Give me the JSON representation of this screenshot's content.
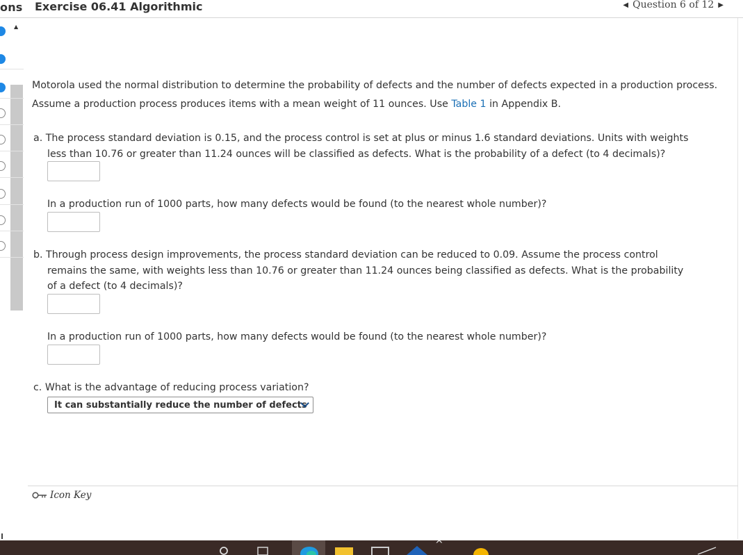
{
  "header": {
    "left_cut_text": "ons",
    "title": "Exercise 06.41 Algorithmic",
    "question_nav": "Question 6 of 12"
  },
  "question": {
    "intro_before_link": "Motorola used the normal distribution to determine the probability of defects and the number of defects expected in a production process. Assume a production process produces items with a mean weight of 11 ounces. Use ",
    "intro_link": "Table 1",
    "intro_after_link": " in Appendix B.",
    "part_a_lead": "a. The process standard deviation is 0.15, and the process control is set at plus or minus 1.6 standard deviations. Units with weights",
    "part_a_cont": "less than 10.76 or greater than 11.24 ounces will be classified as defects. What is the probability of a defect (to 4 decimals)?",
    "part_a_runs": "In a production run of 1000 parts, how many defects would be found (to the nearest whole number)?",
    "part_b_lead": "b. Through process design improvements, the process standard deviation can be reduced to 0.09. Assume the process control",
    "part_b_cont1": "remains the same, with weights less than 10.76 or greater than 11.24 ounces being classified as defects. What is the probability",
    "part_b_cont2": "of a defect (to 4 decimals)?",
    "part_b_runs": "In a production run of 1000 parts, how many defects would be found (to the nearest whole number)?",
    "part_c": "c. What is the advantage of reducing process variation?",
    "part_c_selected": "It can substantially reduce the number of defects",
    "answers": {
      "a_prob": "",
      "a_defects": "",
      "b_prob": "",
      "b_defects": ""
    }
  },
  "footer": {
    "icon_key": "Icon Key"
  },
  "nav_dots": [
    {
      "state": "filled",
      "icon": "current-dot"
    },
    {
      "state": "filled",
      "icon": "answered-dot"
    },
    {
      "state": "filled",
      "icon": "answered-dot"
    },
    {
      "state": "empty",
      "icon": "unanswered-dot"
    },
    {
      "state": "empty",
      "icon": "unanswered-dot"
    },
    {
      "state": "empty",
      "icon": "unanswered-dot"
    },
    {
      "state": "empty",
      "icon": "unanswered-dot"
    },
    {
      "state": "empty",
      "icon": "unanswered-dot"
    },
    {
      "state": "empty",
      "icon": "unanswered-dot"
    }
  ],
  "colors": {
    "link": "#1a6fb5",
    "active_dot": "#1e88e5",
    "taskbar": "#3a2a26"
  }
}
